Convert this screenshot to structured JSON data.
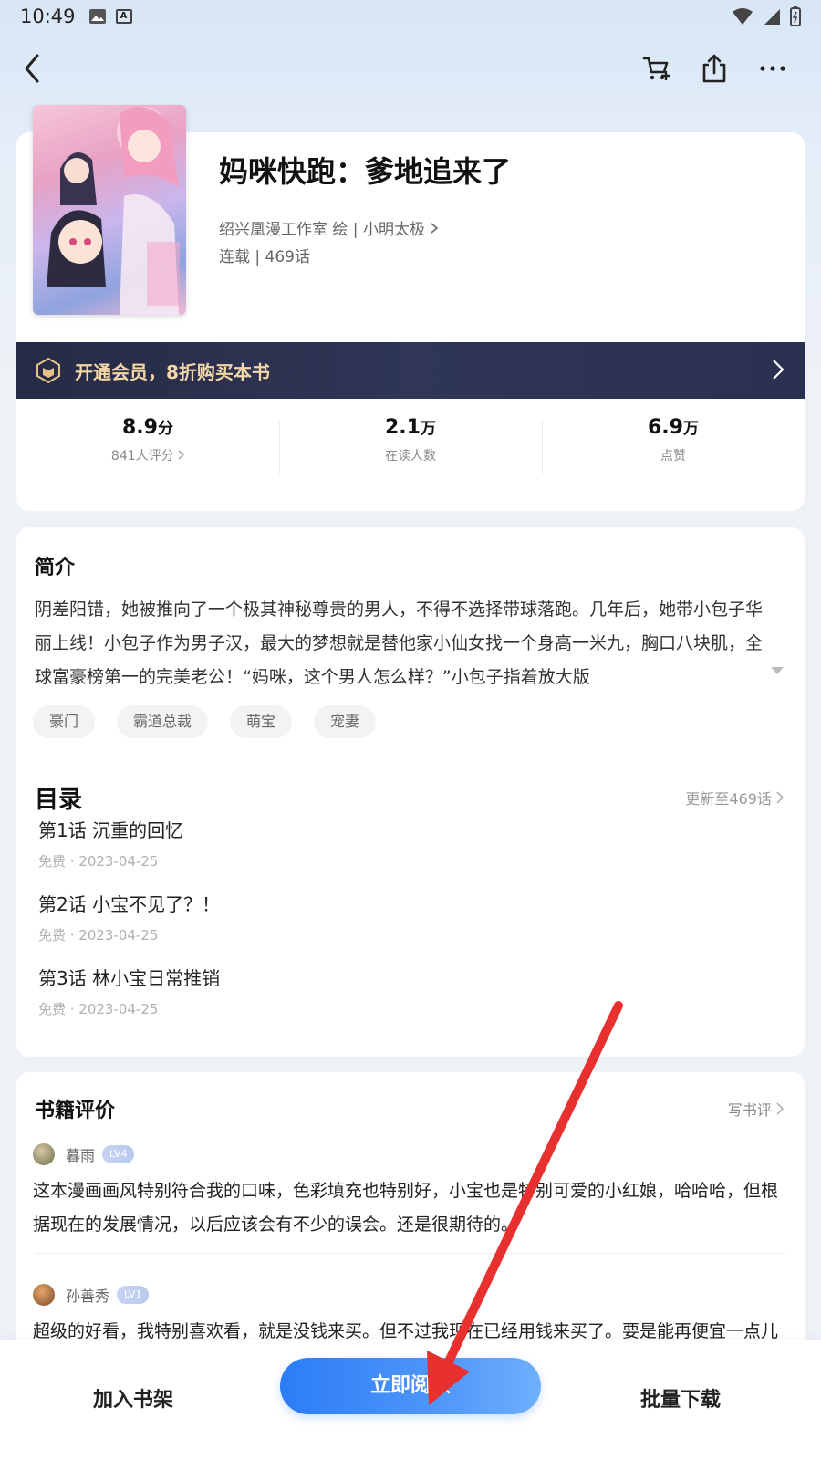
{
  "status_bar": {
    "time": "10:49"
  },
  "book": {
    "title": "妈咪快跑：爹地追来了",
    "author_line": "绍兴凰漫工作室 绘 | 小明太极",
    "status_line": "连载 | 469话"
  },
  "vip_banner": {
    "text": "开通会员，8折购买本书"
  },
  "stats": [
    {
      "value": "8.9",
      "unit": "分",
      "label": "841人评分",
      "has_arrow": true
    },
    {
      "value": "2.1",
      "unit": "万",
      "label": "在读人数",
      "has_arrow": false
    },
    {
      "value": "6.9",
      "unit": "万",
      "label": "点赞",
      "has_arrow": false
    }
  ],
  "intro": {
    "title": "简介",
    "text": "阴差阳错，她被推向了一个极其神秘尊贵的男人，不得不选择带球落跑。几年后，她带小包子华丽上线！小包子作为男子汉，最大的梦想就是替他家小仙女找一个身高一米九，胸口八块肌，全球富豪榜第一的完美老公！“妈咪，这个男人怎么样？”小包子指着放大版",
    "tags": [
      "豪门",
      "霸道总裁",
      "萌宝",
      "宠妻"
    ]
  },
  "toc": {
    "title": "目录",
    "update": "更新至469话",
    "chapters": [
      {
        "title": "第1话 沉重的回忆",
        "meta": "免费 · 2023-04-25"
      },
      {
        "title": "第2话 小宝不见了？！",
        "meta": "免费 · 2023-04-25"
      },
      {
        "title": "第3话 林小宝日常推销",
        "meta": "免费 · 2023-04-25"
      }
    ]
  },
  "reviews": {
    "title": "书籍评价",
    "write_label": "写书评",
    "items": [
      {
        "name": "暮雨",
        "level": "LV4",
        "text": "这本漫画画风特别符合我的口味，色彩填充也特别好，小宝也是特别可爱的小红娘，哈哈哈，但根据现在的发展情况，以后应该会有不少的误会。还是很期待的。"
      },
      {
        "name": "孙善秀",
        "level": "LV1",
        "text": "超级的好看，我特别喜欢看，就是没钱来买。但不过我现在已经用钱来买了。要是能再便宜一点儿就好了，特别爱看这个，妈咪快跑爹地追了。"
      }
    ]
  },
  "bottom": {
    "add_shelf": "加入书架",
    "read_now": "立即阅读",
    "batch_download": "批量下载"
  },
  "colors": {
    "accent_blue": "#2b7cf6",
    "vip_gold": "#f3d7a6",
    "annotation_red": "#e8302e"
  }
}
